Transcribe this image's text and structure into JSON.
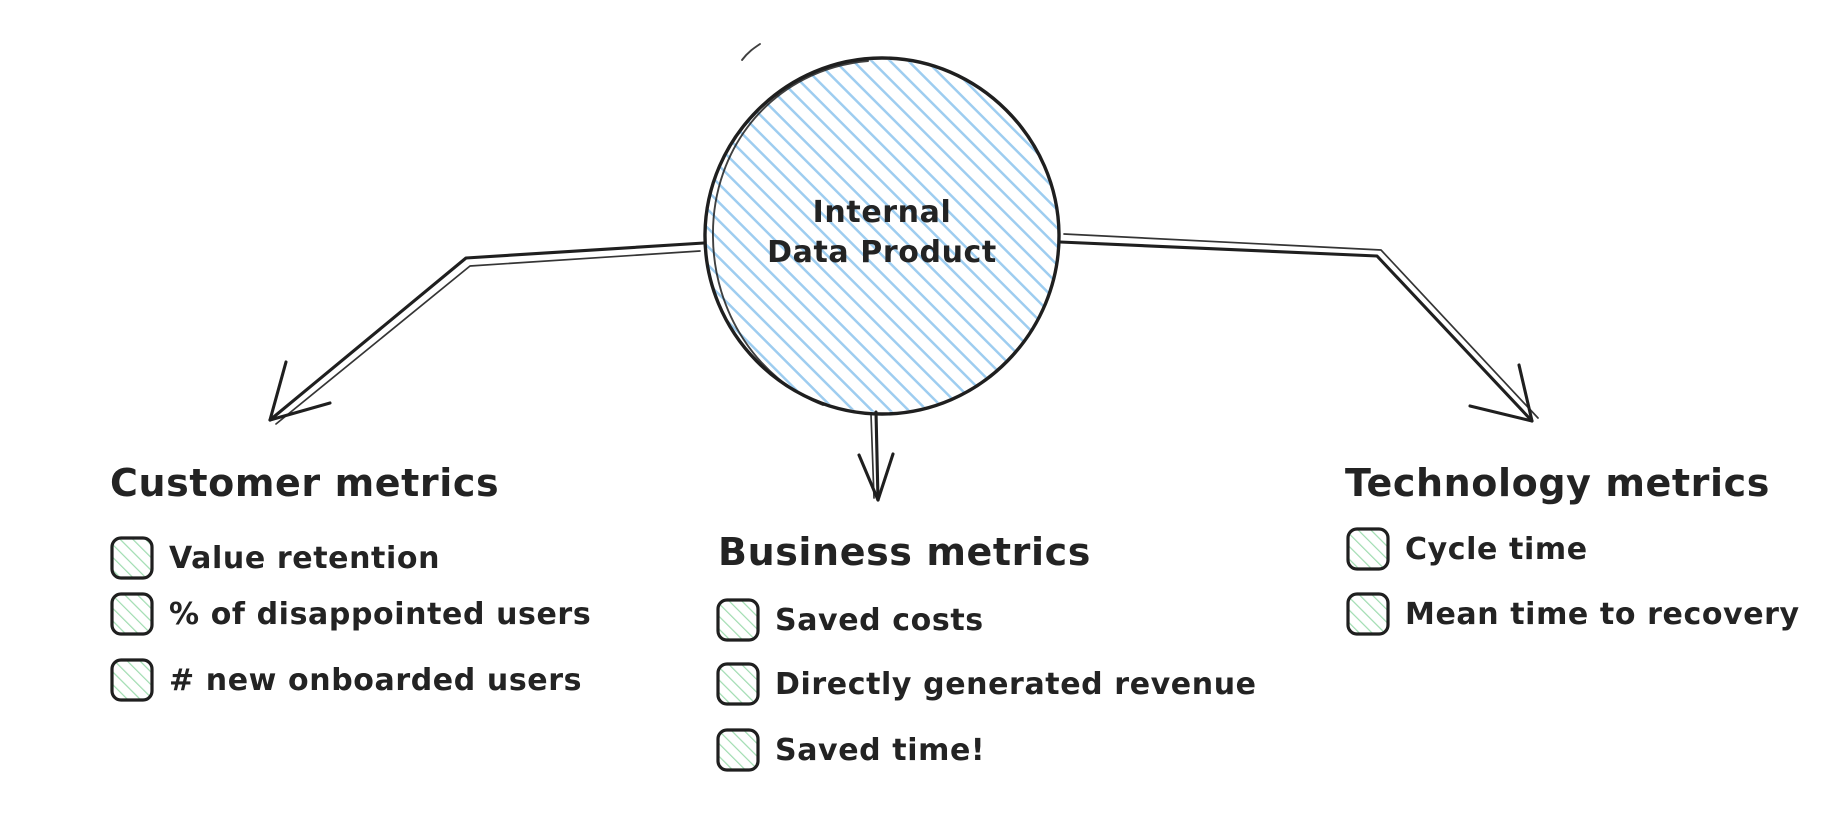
{
  "diagram": {
    "type": "hand-drawn-mindmap",
    "background_color": "#ffffff",
    "ink_color": "#232323",
    "center_node": {
      "shape": "circle",
      "fill_hatch_color": "#9ecdf0",
      "title_line_1": "Internal",
      "title_line_2": "Data Product"
    },
    "checkbox": {
      "shape": "rounded-square",
      "hatch_color": "#9fdcb0"
    },
    "branches": [
      {
        "id": "customer",
        "heading": "Customer metrics",
        "arrow_direction": "down-left",
        "items": [
          "Value retention",
          "% of disappointed users",
          "# new onboarded users"
        ]
      },
      {
        "id": "business",
        "heading": "Business metrics",
        "arrow_direction": "down",
        "items": [
          "Saved costs",
          "Directly generated revenue",
          "Saved time!"
        ]
      },
      {
        "id": "technology",
        "heading": "Technology metrics",
        "arrow_direction": "down-right",
        "items": [
          "Cycle time",
          "Mean time to recovery"
        ]
      }
    ]
  }
}
